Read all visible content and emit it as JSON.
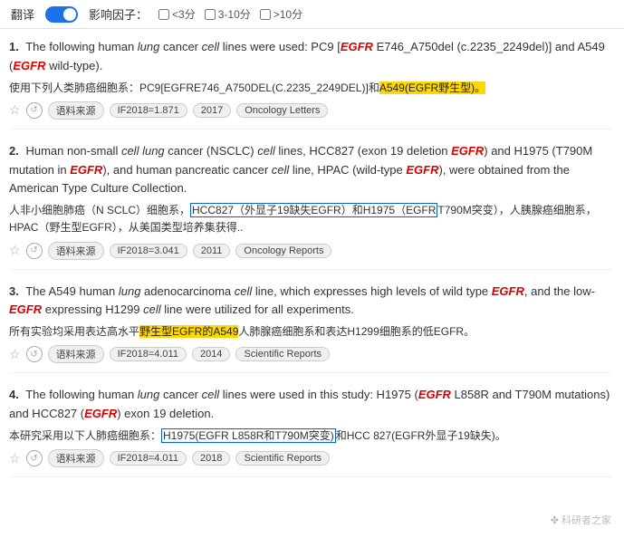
{
  "topbar": {
    "translate_label": "翻译",
    "influence_label": "影响因子：",
    "filters": [
      {
        "id": "f1",
        "label": "<3分",
        "checked": false
      },
      {
        "id": "f2",
        "label": "3-10分",
        "checked": false
      },
      {
        "id": "f3",
        "label": ">10分",
        "checked": false
      }
    ]
  },
  "results": [
    {
      "number": "1.",
      "en_parts": [
        {
          "text": "The following human ",
          "style": "normal"
        },
        {
          "text": "lung",
          "style": "italic"
        },
        {
          "text": " cancer ",
          "style": "normal"
        },
        {
          "text": "cell",
          "style": "italic"
        },
        {
          "text": " lines were used: PC9 [",
          "style": "normal"
        },
        {
          "text": "EGFR",
          "style": "red-italic"
        },
        {
          "text": " E746_A750del (c.2235_2249del)] and A549 (",
          "style": "normal"
        },
        {
          "text": "EGFR",
          "style": "red-italic"
        },
        {
          "text": " wild-type).",
          "style": "normal"
        }
      ],
      "cn_parts": [
        {
          "text": "使用下列人类肺癌细胞系：PC9[EGFRE746_A750DEL(C.2235_2249DEL)]和",
          "style": "normal"
        },
        {
          "text": "A549(EGFR野生型)。",
          "style": "highlight-yellow"
        }
      ],
      "tags": {
        "source": "语料来源",
        "if": "IF2018=1.871",
        "year": "2017",
        "journal": "Oncology Letters"
      }
    },
    {
      "number": "2.",
      "en_parts": [
        {
          "text": "Human non-small ",
          "style": "normal"
        },
        {
          "text": "cell lung",
          "style": "italic"
        },
        {
          "text": " cancer (NSCLC) ",
          "style": "normal"
        },
        {
          "text": "cell",
          "style": "italic"
        },
        {
          "text": " lines, HCC827 (exon 19 deletion ",
          "style": "normal"
        },
        {
          "text": "EGF",
          "style": "red-italic"
        },
        {
          "text": "R) and H1975 (T790M mutation in ",
          "style": "normal"
        },
        {
          "text": "EGFR",
          "style": "red-italic"
        },
        {
          "text": "), and human pancreatic cancer ",
          "style": "normal"
        },
        {
          "text": "cell",
          "style": "italic"
        },
        {
          "text": " line, HPAC (wild-type ",
          "style": "normal"
        },
        {
          "text": "EGFR",
          "style": "red-italic"
        },
        {
          "text": "), were obtained from the American Type Culture Collection.",
          "style": "normal"
        }
      ],
      "cn_parts": [
        {
          "text": "人非小细胞肺癌（N SCLC）细胞系，",
          "style": "normal"
        },
        {
          "text": "HCC827（外显子19缺失EGFR）和H1975（EGFR",
          "style": "highlight-blue"
        },
        {
          "text": "T790M突变），人胰腺癌细胞系，HPAC（野生型EGFR），从美国类型培养集获得..",
          "style": "normal"
        }
      ],
      "tags": {
        "source": "语料来源",
        "if": "IF2018=3.041",
        "year": "2011",
        "journal": "Oncology Reports"
      }
    },
    {
      "number": "3.",
      "en_parts": [
        {
          "text": "The A549 human ",
          "style": "normal"
        },
        {
          "text": "lung",
          "style": "italic"
        },
        {
          "text": " adenocarcinoma ",
          "style": "normal"
        },
        {
          "text": "cell",
          "style": "italic"
        },
        {
          "text": " line, which expresses high levels of wild type ",
          "style": "normal"
        },
        {
          "text": "EGFR",
          "style": "red-italic"
        },
        {
          "text": ", and the low-",
          "style": "normal"
        },
        {
          "text": "EGFR",
          "style": "red-italic"
        },
        {
          "text": " expressing H1299 ",
          "style": "normal"
        },
        {
          "text": "cell",
          "style": "italic"
        },
        {
          "text": " line were utilized for all experiments.",
          "style": "normal"
        }
      ],
      "cn_parts": [
        {
          "text": "所有实验均采用表达高水平",
          "style": "normal"
        },
        {
          "text": "野生型EGFR的A549",
          "style": "highlight-yellow"
        },
        {
          "text": "人肺腺癌细胞系和表达H1299细胞系的低EGFR。",
          "style": "normal"
        }
      ],
      "tags": {
        "source": "语料来源",
        "if": "IF2018=4.011",
        "year": "2014",
        "journal": "Scientific Reports"
      }
    },
    {
      "number": "4.",
      "en_parts": [
        {
          "text": "The following human ",
          "style": "normal"
        },
        {
          "text": "lung",
          "style": "italic"
        },
        {
          "text": " cancer ",
          "style": "normal"
        },
        {
          "text": "cell",
          "style": "italic"
        },
        {
          "text": " lines were used in this study: H1975 (",
          "style": "normal"
        },
        {
          "text": "EGFR",
          "style": "red-italic"
        },
        {
          "text": " L858R and T790M mutations) and HCC827 (",
          "style": "normal"
        },
        {
          "text": "EGFR",
          "style": "red-italic"
        },
        {
          "text": ") exon 19 deletion.",
          "style": "normal"
        }
      ],
      "cn_parts": [
        {
          "text": "本研究采用以下人肺癌细胞系：",
          "style": "normal"
        },
        {
          "text": "H1975(EGFR L858R和T790M突变)",
          "style": "highlight-blue"
        },
        {
          "text": "和HCC 827(EGFR外显子19缺失)。",
          "style": "normal"
        }
      ],
      "tags": {
        "source": "语料来源",
        "if": "IF2018=4.011",
        "year": "2018",
        "journal": "Scientific Reports"
      }
    }
  ],
  "watermark": "✤ 科研者之家"
}
